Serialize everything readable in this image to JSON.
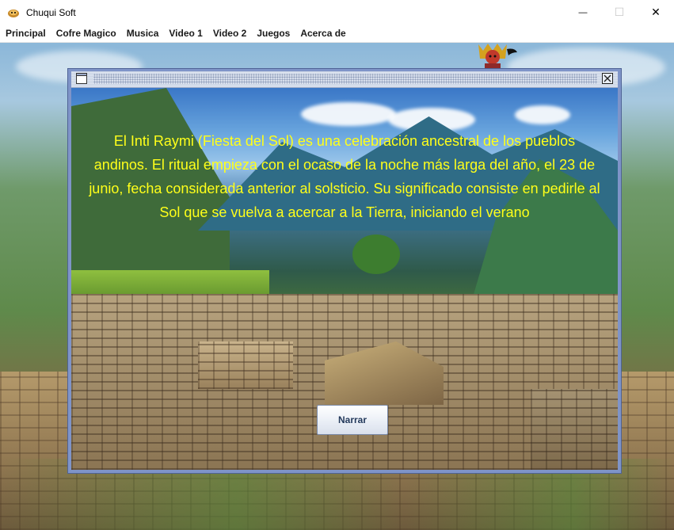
{
  "window": {
    "title": "Chuqui Soft",
    "controls": {
      "minimize": "—",
      "maximize": "☐",
      "close": "✕"
    }
  },
  "menubar": {
    "items": [
      "Principal",
      "Cofre Magico",
      "Musica",
      "Video 1",
      "Video 2",
      "Juegos",
      "Acerca de"
    ]
  },
  "internal_frame": {
    "title": "",
    "narrative": "El Inti Raymi (Fiesta del Sol) es una celebración ancestral de los pueblos andinos. El ritual empieza con el ocaso de la noche más larga del año, el 23 de junio, fecha considerada anterior al solsticio. Su significado consiste en pedirle al Sol que se vuelva a acercar a la Tierra, iniciando el verano",
    "button_label": "Narrar"
  },
  "colors": {
    "narrative_text": "#ffff1a",
    "frame_border": "#7f94c8",
    "button_text": "#243a5c"
  },
  "icons": [
    "app-icon",
    "minimize-icon",
    "maximize-icon",
    "close-icon",
    "frame-icon",
    "frame-close-icon",
    "mask-logo"
  ]
}
